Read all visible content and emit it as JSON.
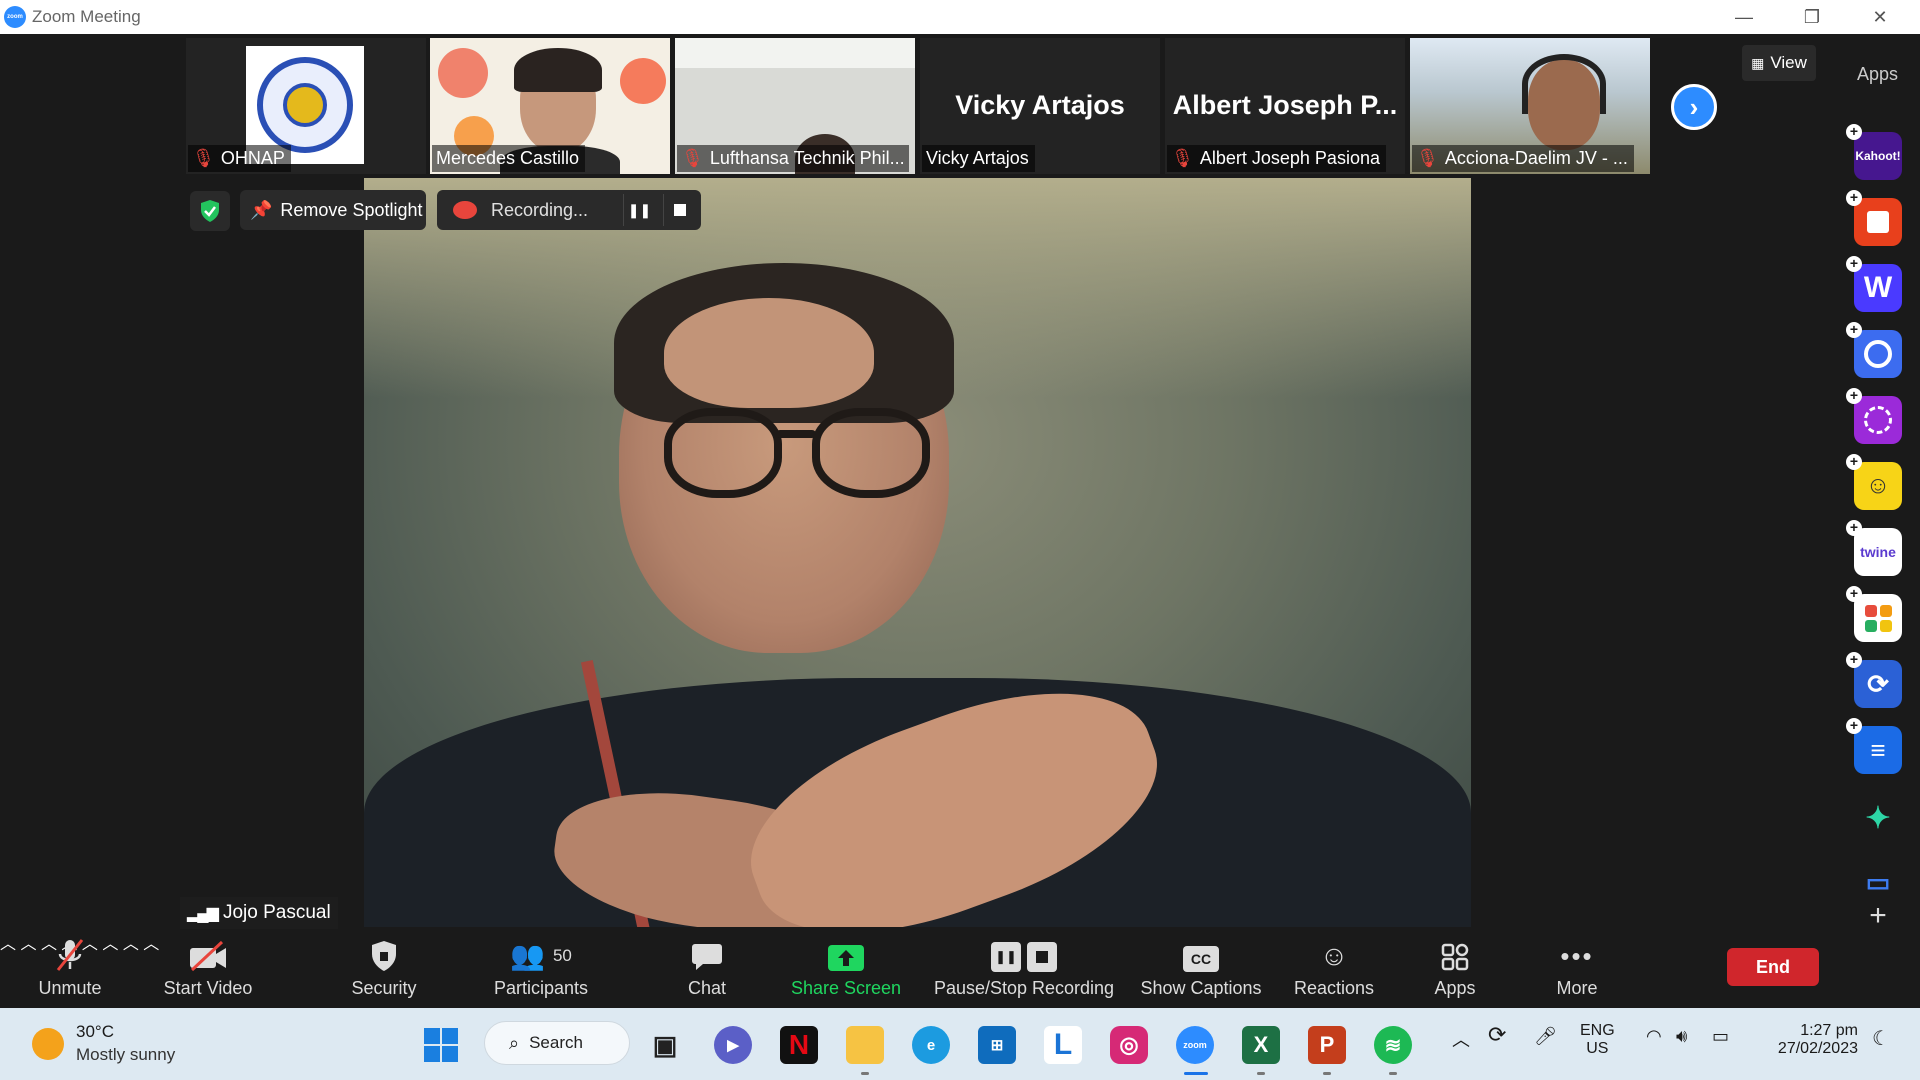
{
  "window": {
    "title": "Zoom Meeting",
    "minimize": "—",
    "restore": "❐",
    "close": "✕"
  },
  "thumbnails": [
    {
      "name": "OHNAP",
      "muted": true,
      "type": "logo"
    },
    {
      "name": "Mercedes Castillo",
      "muted": false,
      "type": "video"
    },
    {
      "name": "Lufthansa Technik Phil...",
      "muted": true,
      "type": "video"
    },
    {
      "name": "Vicky Artajos",
      "display_name": "Vicky Artajos",
      "muted": false,
      "type": "name"
    },
    {
      "name": "Albert Joseph Pasiona",
      "display_name": "Albert Joseph P...",
      "muted": true,
      "type": "name"
    },
    {
      "name": "Acciona-Daelim JV - ...",
      "muted": true,
      "type": "video"
    }
  ],
  "view_button": "View",
  "spotlight": {
    "remove_label": "Remove Spotlight",
    "recording_label": "Recording...",
    "speaker_name": "Jojo Pascual"
  },
  "apps_panel": {
    "title": "Apps",
    "items": [
      {
        "name": "Kahoot!",
        "label": "Kahoot!",
        "color": "#46178f"
      },
      {
        "name": "App 2",
        "label": "",
        "color": "#e8401c"
      },
      {
        "name": "Wooclap",
        "label": "W",
        "color": "#4a3aff"
      },
      {
        "name": "App 4",
        "label": "",
        "color": "#3c6cf0"
      },
      {
        "name": "App 5",
        "label": "",
        "color": "#9b2ad9"
      },
      {
        "name": "App 6",
        "label": "",
        "color": "#f7d417"
      },
      {
        "name": "Twine",
        "label": "twine",
        "color": "#ffffff"
      },
      {
        "name": "App 8",
        "label": "",
        "color": "#ffffff"
      },
      {
        "name": "App 9",
        "label": "",
        "color": "#2b61d6"
      },
      {
        "name": "App 10",
        "label": "",
        "color": "#1b6be6"
      }
    ]
  },
  "toolbar": {
    "unmute": "Unmute",
    "start_video": "Start Video",
    "security": "Security",
    "participants": "Participants",
    "participant_count": "50",
    "chat": "Chat",
    "share_screen": "Share Screen",
    "pause_stop_recording": "Pause/Stop Recording",
    "show_captions": "Show Captions",
    "reactions": "Reactions",
    "apps": "Apps",
    "more": "More",
    "end": "End",
    "cc_label": "CC"
  },
  "taskbar": {
    "weather_temp": "30°C",
    "weather_desc": "Mostly sunny",
    "search_label": "Search",
    "lang_top": "ENG",
    "lang_bottom": "US",
    "time": "1:27 pm",
    "date": "27/02/2023"
  },
  "colors": {
    "accent": "#2d8cff",
    "end": "#d0262c",
    "share": "#1fd65f",
    "muted": "#e8453c"
  }
}
